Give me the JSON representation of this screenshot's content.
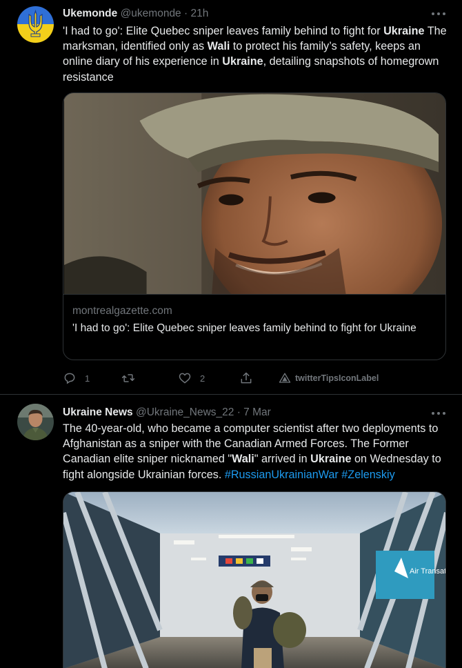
{
  "tweets": [
    {
      "author": {
        "name": "Ukemonde",
        "handle": "@ukemonde",
        "time": "21h"
      },
      "text": {
        "p1": "'I had to go': Elite Quebec sniper leaves family behind to fight for ",
        "k1": "Ukraine",
        "p2": " The marksman, identified only as ",
        "k2": "Wali",
        "p3": " to protect his family’s safety, keeps an online diary of his experience in ",
        "k3": "Ukraine",
        "p4": ", detailing snapshots of homegrown resistance"
      },
      "card": {
        "domain": "montrealgazette.com",
        "title": "'I had to go': Elite Quebec sniper leaves family behind to fight for Ukraine"
      },
      "actions": {
        "reply_count": "1",
        "retweet_count": "",
        "like_count": "2",
        "tips_label": "twitterTipsIconLabel"
      }
    },
    {
      "author": {
        "name": "Ukraine News",
        "handle": "@Ukraine_News_22",
        "time": "7 Mar"
      },
      "text": {
        "p1": "The 40-year-old, who became a computer scientist after two deployments to Afghanistan as a sniper with the Canadian Armed Forces. The Former Canadian elite sniper nicknamed \"",
        "k1": "Wali",
        "p2": "\" arrived in ",
        "k2": "Ukraine",
        "p3": " on Wednesday to fight alongside Ukrainian forces. ",
        "h1": "#RussianUkrainianWar",
        "p4": " ",
        "h2": "#Zelenskiy"
      },
      "media": {
        "sign_text": "Air Transat"
      }
    }
  ],
  "colors": {
    "background": "#000000",
    "text": "#e7e9ea",
    "muted": "#71767b",
    "link": "#1d9bf0",
    "border": "#2f3336"
  },
  "separator": "·"
}
